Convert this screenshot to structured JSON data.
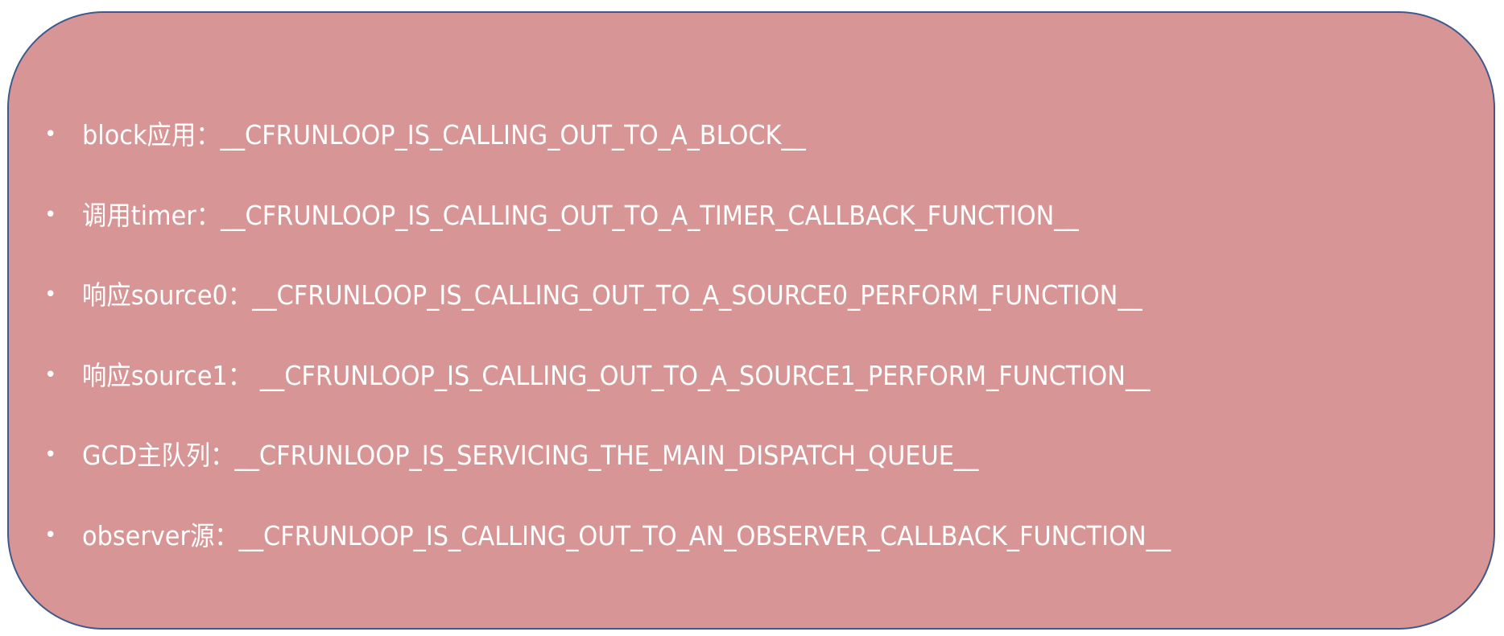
{
  "items": [
    {
      "text": "block应用：__CFRUNLOOP_IS_CALLING_OUT_TO_A_BLOCK__"
    },
    {
      "text": "调用timer：__CFRUNLOOP_IS_CALLING_OUT_TO_A_TIMER_CALLBACK_FUNCTION__"
    },
    {
      "text": "响应source0：__CFRUNLOOP_IS_CALLING_OUT_TO_A_SOURCE0_PERFORM_FUNCTION__"
    },
    {
      "text": "响应source1： __CFRUNLOOP_IS_CALLING_OUT_TO_A_SOURCE1_PERFORM_FUNCTION__"
    },
    {
      "text": "GCD主队列：__CFRUNLOOP_IS_SERVICING_THE_MAIN_DISPATCH_QUEUE__"
    },
    {
      "text": "observer源：__CFRUNLOOP_IS_CALLING_OUT_TO_AN_OBSERVER_CALLBACK_FUNCTION__"
    }
  ],
  "bullet": "•",
  "colors": {
    "card_fill": "#d89595",
    "card_border": "#41598a",
    "text": "#ffffff"
  }
}
